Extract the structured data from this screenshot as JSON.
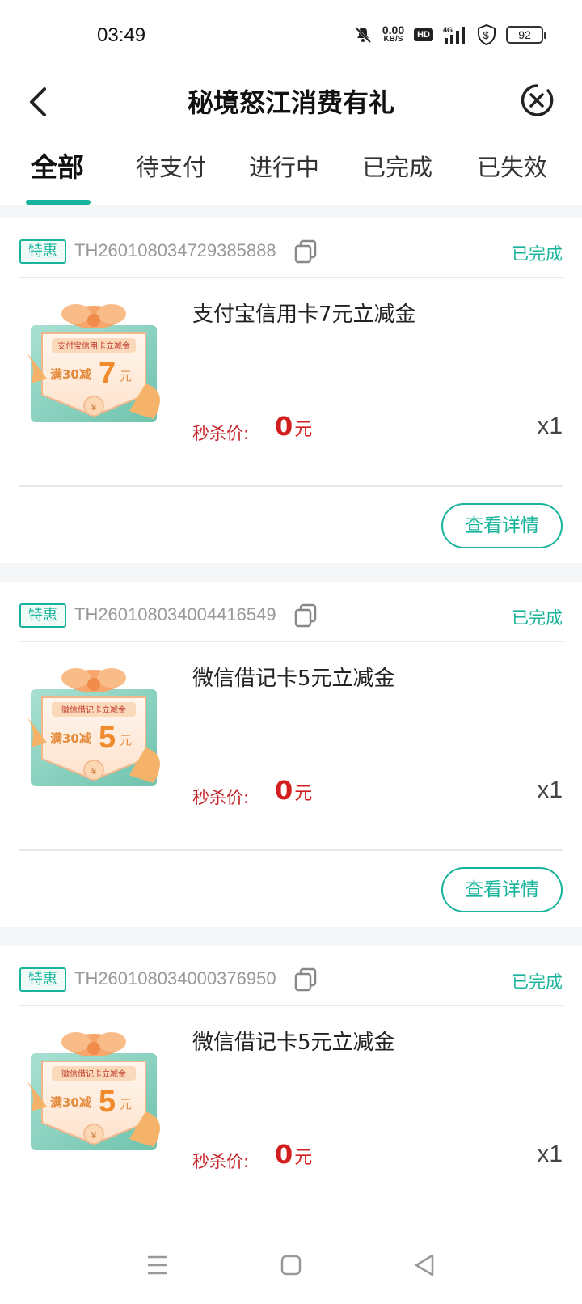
{
  "status_bar": {
    "time": "03:49",
    "net_speed_value": "0.00",
    "net_speed_unit": "KB/S",
    "hd": "HD",
    "network": "4G",
    "battery": "92"
  },
  "header": {
    "title": "秘境怒江消费有礼"
  },
  "tabs": [
    "全部",
    "待支付",
    "进行中",
    "已完成",
    "已失效"
  ],
  "colors": {
    "accent": "#17b39a",
    "price": "#d21e1e"
  },
  "orders": [
    {
      "tag": "特惠",
      "order_no": "TH260108034729385888",
      "status": "已完成",
      "name": "支付宝信用卡7元立减金",
      "coupon_title": "支付宝信用卡立减金",
      "coupon_condition": "满30减",
      "coupon_amount": "7",
      "coupon_unit": "元",
      "price_label": "秒杀价:",
      "price": "0",
      "price_unit": "元",
      "qty": "x1",
      "action": "查看详情"
    },
    {
      "tag": "特惠",
      "order_no": "TH260108034004416549",
      "status": "已完成",
      "name": "微信借记卡5元立减金",
      "coupon_title": "微信借记卡立减金",
      "coupon_condition": "满30减",
      "coupon_amount": "5",
      "coupon_unit": "元",
      "price_label": "秒杀价:",
      "price": "0",
      "price_unit": "元",
      "qty": "x1",
      "action": "查看详情"
    },
    {
      "tag": "特惠",
      "order_no": "TH260108034000376950",
      "status": "已完成",
      "name": "微信借记卡5元立减金",
      "coupon_title": "微信借记卡立减金",
      "coupon_condition": "满30减",
      "coupon_amount": "5",
      "coupon_unit": "元",
      "price_label": "秒杀价:",
      "price": "0",
      "price_unit": "元",
      "qty": "x1"
    }
  ],
  "coupon_yen": "¥"
}
